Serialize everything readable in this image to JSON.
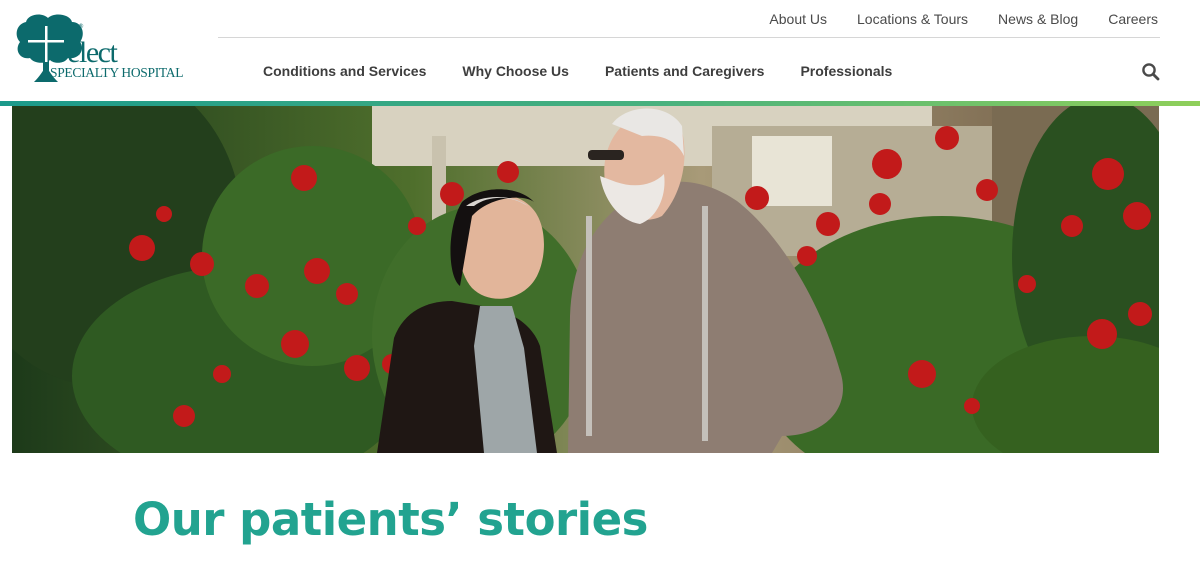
{
  "brand": {
    "name": "Select",
    "tagline": "SPECIALTY HOSPITAL",
    "color": "#0c6a6c"
  },
  "utility_nav": [
    {
      "label": "About Us"
    },
    {
      "label": "Locations & Tours"
    },
    {
      "label": "News & Blog"
    },
    {
      "label": "Careers"
    }
  ],
  "main_nav": [
    {
      "label": "Conditions and Services"
    },
    {
      "label": "Why Choose Us"
    },
    {
      "label": "Patients and Caregivers"
    },
    {
      "label": "Professionals"
    }
  ],
  "search": {
    "icon": "search-icon"
  },
  "hero": {
    "image": "hero-photo"
  },
  "page": {
    "title": "Our patients’ stories"
  },
  "colors": {
    "accent": "#22a390",
    "brand_teal": "#0c6a6c",
    "bar_start": "#1b9a8b",
    "bar_end": "#8fcf5a"
  }
}
